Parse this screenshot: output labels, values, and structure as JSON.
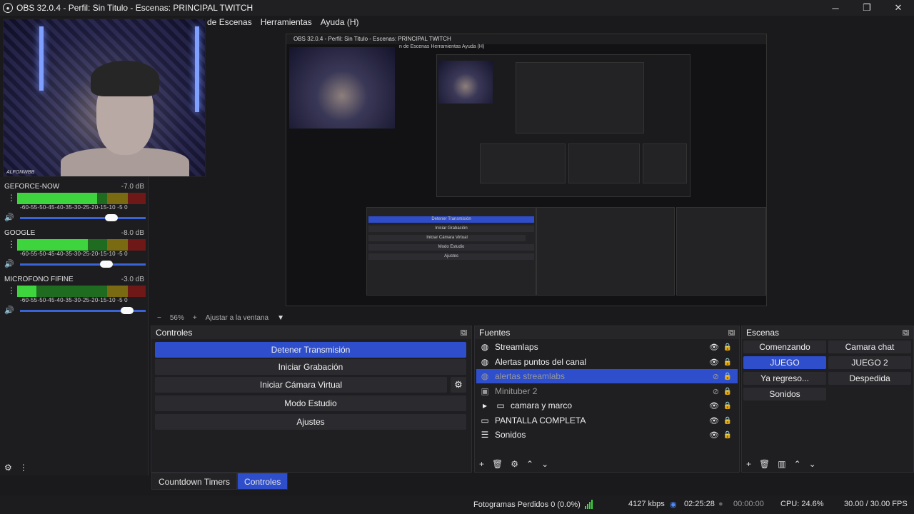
{
  "window": {
    "title": "OBS 32.0.4 - Perfil: Sin Titulo - Escenas: PRINCIPAL TWITCH",
    "minimize": "─",
    "maximize": "❐",
    "close": "✕"
  },
  "menu": [
    "n de Escenas",
    "Herramientas",
    "Ayuda (H)"
  ],
  "webcam": {
    "tag": "ALFONWBB"
  },
  "mixer": {
    "tracks": [
      {
        "name": "GEFORCE-NOW",
        "db": "-7.0 dB",
        "level": 0.62,
        "volume": 0.73
      },
      {
        "name": "GOOGLE",
        "db": "-8.0 dB",
        "level": 0.55,
        "volume": 0.69
      },
      {
        "name": "MICROFONO FIFINE",
        "db": "-3.0 dB",
        "level": 0.15,
        "volume": 0.85
      }
    ],
    "ticks": "-60-55-50-45-40-35-30-25-20-15-10 -5  0"
  },
  "preview": {
    "title": "OBS 32.0.4 - Perfil: Sin Titulo - Escenas: PRINCIPAL TWITCH",
    "menu": "n de Escenas   Herramientas   Ayuda (H)"
  },
  "zoom": {
    "minus": "−",
    "value": "56%",
    "plus": "+",
    "fit": "Ajustar a la ventana"
  },
  "controls": {
    "title": "Controles",
    "buttons": [
      "Detener Transmisión",
      "Iniciar Grabación",
      "Iniciar Cámara Virtual",
      "Modo Estudio",
      "Ajustes"
    ]
  },
  "sources": {
    "title": "Fuentes",
    "items": [
      "Streamlaps",
      "Alertas puntos del canal",
      "alertas streamlabs",
      "Minituber 2",
      "camara y marco",
      "PANTALLA COMPLETA",
      "Sonidos"
    ]
  },
  "scenes": {
    "title": "Escenas",
    "items": [
      "Comenzando",
      "Camara chat",
      "JUEGO",
      "JUEGO 2",
      "Ya regreso...",
      "Despedida",
      "Sonidos"
    ]
  },
  "tabs": [
    "Countdown Timers",
    "Controles"
  ],
  "status": {
    "dropped": "Fotogramas Perdidos 0 (0.0%)",
    "kbps": "4127 kbps",
    "stream_time": "02:25:28",
    "rec_time": "00:00:00",
    "cpu": "CPU: 24.6%",
    "fps": "30.00 / 30.00 FPS"
  },
  "colors": {
    "accent": "#2e4ecb",
    "meter_green": "#3ed43e"
  }
}
